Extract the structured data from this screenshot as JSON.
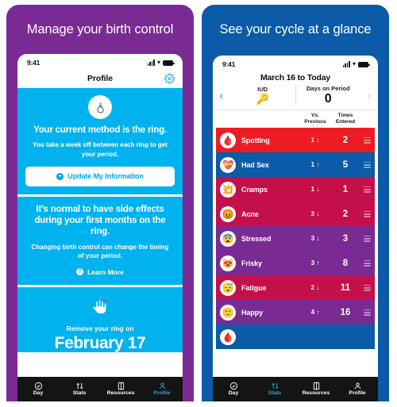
{
  "panels": {
    "left": {
      "headline": "Manage your birth control",
      "bg": "#7A2A93",
      "status": {
        "time": "9:41"
      },
      "nav": {
        "title": "Profile",
        "gear_icon": "gear-icon"
      },
      "cards": [
        {
          "icon": "ring-icon",
          "heading": "Your current method is the ring.",
          "body": "You take a week off between each ring to get your period.",
          "button": {
            "label": "Update My Information",
            "icon": "plus-circle-icon"
          }
        },
        {
          "heading": "It’s normal to have side effects during your first months on the ring.",
          "body": "Changing birth control can change the timing of your period.",
          "link": {
            "label": "Learn More",
            "icon": "question-circle-icon"
          }
        },
        {
          "icon": "hand-pointing-icon",
          "label": "Remove your ring on",
          "date": "February 17"
        }
      ],
      "tabs": [
        {
          "label": "Day",
          "icon": "check-circle-icon",
          "active": false
        },
        {
          "label": "Stats",
          "icon": "sort-arrows-icon",
          "active": false
        },
        {
          "label": "Resources",
          "icon": "book-icon",
          "active": false
        },
        {
          "label": "Profile",
          "icon": "person-icon",
          "active": true
        }
      ]
    },
    "right": {
      "headline": "See your cycle at a glance",
      "bg": "#0B5BA8",
      "status": {
        "time": "9:41"
      },
      "range_title": "March 16 to Today",
      "prev_arrow": "chevron-left-icon",
      "next_arrow": "chevron-right-icon",
      "summary": [
        {
          "label": "IUD",
          "emoji": "🔑",
          "value": ""
        },
        {
          "label": "Days on Period",
          "emoji": "",
          "value": "0"
        }
      ],
      "columns": {
        "delta": "Vs.\nPrevious",
        "delta_l1": "Vs.",
        "delta_l2": "Previous",
        "count_l1": "Times",
        "count_l2": "Entered"
      },
      "rows": [
        {
          "name": "Spotting",
          "emoji": "🩸",
          "delta": "1",
          "dir": "↓",
          "count": "2",
          "color": "#ED1C24"
        },
        {
          "name": "Had Sex",
          "emoji": "💝",
          "delta": "1",
          "dir": "↑",
          "count": "5",
          "color": "#0B5BA8"
        },
        {
          "name": "Cramps",
          "emoji": "💥",
          "delta": "1",
          "dir": "↓",
          "count": "1",
          "color": "#C4104A"
        },
        {
          "name": "Acne",
          "emoji": "😡",
          "delta": "3",
          "dir": "↓",
          "count": "2",
          "color": "#C4104A"
        },
        {
          "name": "Stressed",
          "emoji": "😨",
          "delta": "3",
          "dir": "↓",
          "count": "3",
          "color": "#7A2A93"
        },
        {
          "name": "Frisky",
          "emoji": "😻",
          "delta": "3",
          "dir": "↑",
          "count": "8",
          "color": "#7A2A93"
        },
        {
          "name": "Fatigue",
          "emoji": "😴",
          "delta": "2",
          "dir": "↓",
          "count": "11",
          "color": "#C4104A"
        },
        {
          "name": "Happy",
          "emoji": "🙂",
          "delta": "4",
          "dir": "↑",
          "count": "16",
          "color": "#7A2A93"
        },
        {
          "name": "",
          "emoji": "🩸",
          "delta": "",
          "dir": "",
          "count": "",
          "color": "#0B5BA8"
        }
      ],
      "tabs": [
        {
          "label": "Day",
          "icon": "check-circle-icon",
          "active": false
        },
        {
          "label": "Stats",
          "icon": "sort-arrows-icon",
          "active": true
        },
        {
          "label": "Resources",
          "icon": "book-icon",
          "active": false
        },
        {
          "label": "Profile",
          "icon": "person-icon",
          "active": false
        }
      ]
    }
  }
}
